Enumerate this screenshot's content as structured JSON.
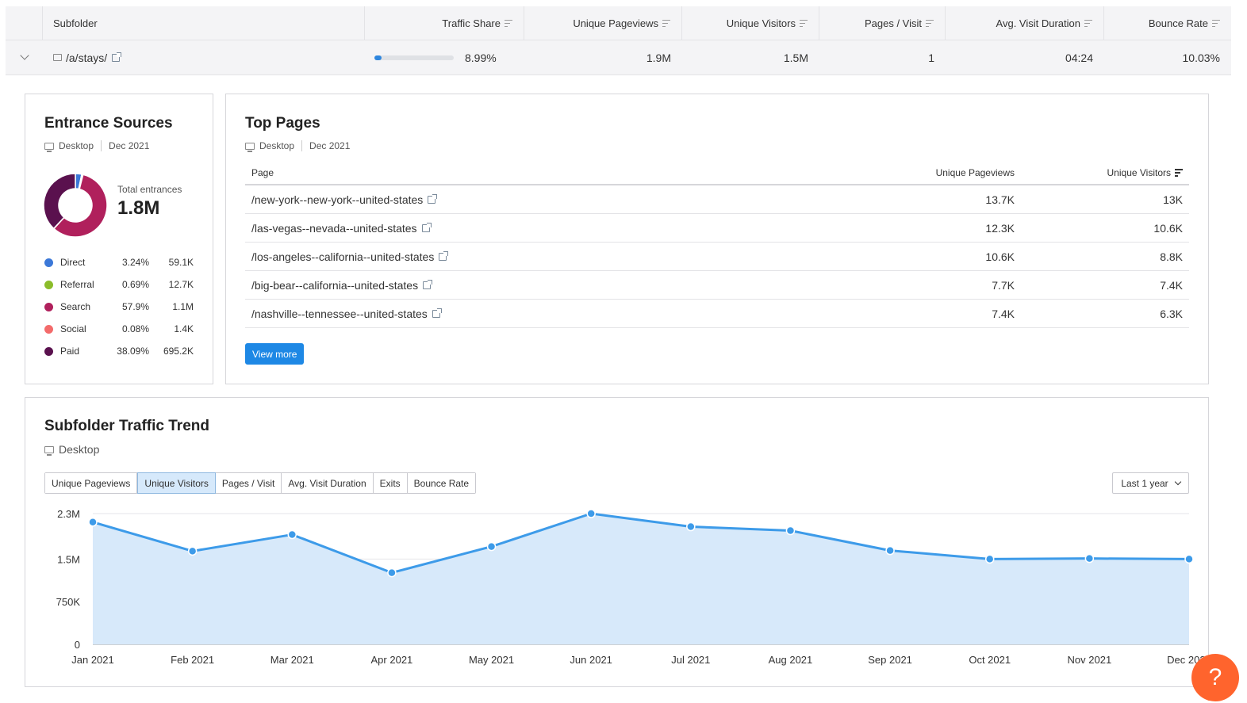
{
  "table": {
    "headers": [
      "Subfolder",
      "Traffic Share",
      "Unique Pageviews",
      "Unique Visitors",
      "Pages / Visit",
      "Avg. Visit Duration",
      "Bounce Rate"
    ],
    "row": {
      "subfolder": "/a/stays/",
      "traffic_share": "8.99%",
      "traffic_share_fraction": 0.0899,
      "unique_pageviews": "1.9M",
      "unique_visitors": "1.5M",
      "pages_per_visit": "1",
      "avg_visit_duration": "04:24",
      "bounce_rate": "10.03%"
    }
  },
  "entrance": {
    "title": "Entrance Sources",
    "device": "Desktop",
    "date": "Dec 2021",
    "total_label": "Total entrances",
    "total_value": "1.8M",
    "sources": [
      {
        "name": "Direct",
        "pct": "3.24%",
        "value": "59.1K",
        "share": 3.24,
        "color": "#3b78d8"
      },
      {
        "name": "Referral",
        "pct": "0.69%",
        "value": "12.7K",
        "share": 0.69,
        "color": "#8bbc2a"
      },
      {
        "name": "Search",
        "pct": "57.9%",
        "value": "1.1M",
        "share": 57.9,
        "color": "#b0205c"
      },
      {
        "name": "Social",
        "pct": "0.08%",
        "value": "1.4K",
        "share": 0.08,
        "color": "#f36b6b"
      },
      {
        "name": "Paid",
        "pct": "38.09%",
        "value": "695.2K",
        "share": 38.09,
        "color": "#5a114e"
      }
    ]
  },
  "top_pages": {
    "title": "Top Pages",
    "device": "Desktop",
    "date": "Dec 2021",
    "headers": [
      "Page",
      "Unique Pageviews",
      "Unique Visitors"
    ],
    "rows": [
      {
        "page": "/new-york--new-york--united-states",
        "pageviews": "13.7K",
        "visitors": "13K"
      },
      {
        "page": "/las-vegas--nevada--united-states",
        "pageviews": "12.3K",
        "visitors": "10.6K"
      },
      {
        "page": "/los-angeles--california--united-states",
        "pageviews": "10.6K",
        "visitors": "8.8K"
      },
      {
        "page": "/big-bear--california--united-states",
        "pageviews": "7.7K",
        "visitors": "7.4K"
      },
      {
        "page": "/nashville--tennessee--united-states",
        "pageviews": "7.4K",
        "visitors": "6.3K"
      }
    ],
    "view_more": "View more"
  },
  "trend": {
    "title": "Subfolder Traffic Trend",
    "device": "Desktop",
    "tabs": [
      "Unique Pageviews",
      "Unique Visitors",
      "Pages / Visit",
      "Avg. Visit Duration",
      "Exits",
      "Bounce Rate"
    ],
    "active_tab": "Unique Visitors",
    "range": "Last 1 year"
  },
  "help": "?",
  "chart_data": {
    "type": "area",
    "x": [
      "Jan 2021",
      "Feb 2021",
      "Mar 2021",
      "Apr 2021",
      "May 2021",
      "Jun 2021",
      "Jul 2021",
      "Aug 2021",
      "Sep 2021",
      "Oct 2021",
      "Nov 2021",
      "Dec 2021"
    ],
    "series": [
      {
        "values": [
          2.15,
          1.64,
          1.93,
          1.26,
          1.72,
          2.3,
          2.07,
          2.0,
          1.65,
          1.5,
          1.51,
          1.5
        ]
      }
    ],
    "unit": "M",
    "yticks": [
      "0",
      "750K",
      "1.5M",
      "2.3M"
    ],
    "ytick_values": [
      0,
      0.75,
      1.5,
      2.3
    ],
    "ylim": [
      0,
      2.3
    ],
    "grid": true,
    "colors": {
      "line": "#3d9be9",
      "fill": "#d7e9fa"
    }
  }
}
